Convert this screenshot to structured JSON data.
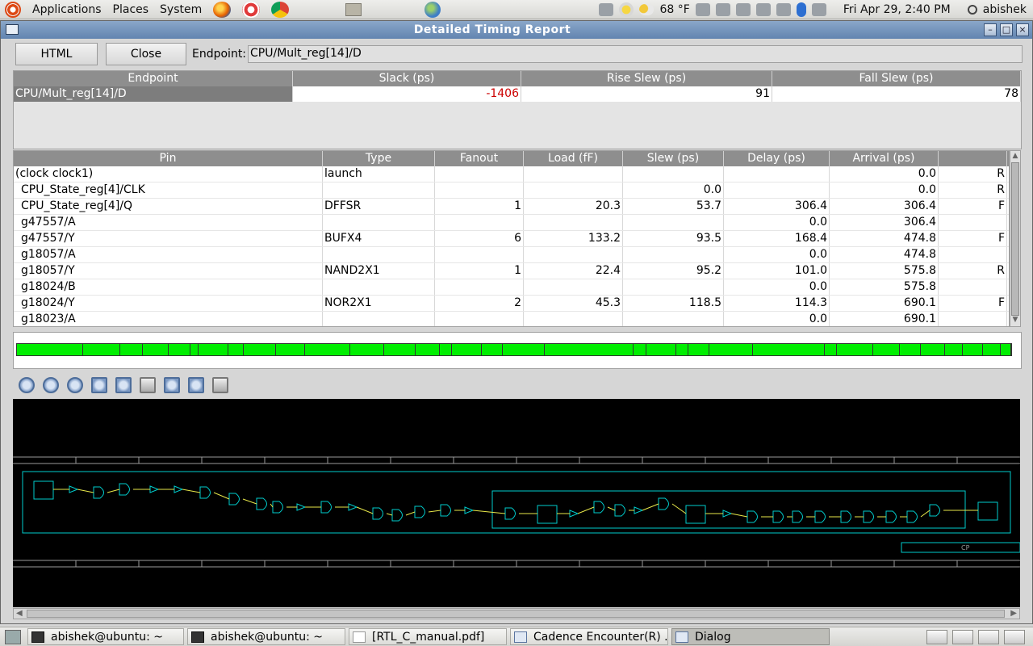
{
  "top_panel": {
    "menus": [
      "Applications",
      "Places",
      "System"
    ],
    "weather": "68 °F",
    "clock": "Fri Apr 29,  2:40 PM",
    "user": "abishek"
  },
  "window": {
    "title": "Detailed Timing Report",
    "html_label": "HTML",
    "close_label": "Close",
    "endpoint_label": "Endpoint:",
    "endpoint_value": "CPU/Mult_reg[14]/D"
  },
  "summary": {
    "headers": [
      "Endpoint",
      "Slack (ps)",
      "Rise Slew (ps)",
      "Fall Slew (ps)"
    ],
    "row": {
      "endpoint": "CPU/Mult_reg[14]/D",
      "slack": "-1406",
      "rise": "91",
      "fall": "78"
    }
  },
  "path": {
    "headers": [
      "Pin",
      "Type",
      "Fanout",
      "Load (fF)",
      "Slew (ps)",
      "Delay (ps)",
      "Arrival (ps)",
      ""
    ],
    "rows": [
      {
        "pin": "(clock clock1)",
        "type": "launch",
        "fanout": "",
        "load": "",
        "slew": "",
        "delay": "",
        "arrival": "0.0",
        "edge": "R",
        "indent": false
      },
      {
        "pin": "CPU_State_reg[4]/CLK",
        "type": "",
        "fanout": "",
        "load": "",
        "slew": "0.0",
        "delay": "",
        "arrival": "0.0",
        "edge": "R",
        "indent": true
      },
      {
        "pin": "CPU_State_reg[4]/Q",
        "type": "DFFSR",
        "fanout": "1",
        "load": "20.3",
        "slew": "53.7",
        "delay": "306.4",
        "arrival": "306.4",
        "edge": "F",
        "indent": true
      },
      {
        "pin": "g47557/A",
        "type": "",
        "fanout": "",
        "load": "",
        "slew": "",
        "delay": "0.0",
        "arrival": "306.4",
        "edge": "",
        "indent": true
      },
      {
        "pin": "g47557/Y",
        "type": "BUFX4",
        "fanout": "6",
        "load": "133.2",
        "slew": "93.5",
        "delay": "168.4",
        "arrival": "474.8",
        "edge": "F",
        "indent": true
      },
      {
        "pin": "g18057/A",
        "type": "",
        "fanout": "",
        "load": "",
        "slew": "",
        "delay": "0.0",
        "arrival": "474.8",
        "edge": "",
        "indent": true
      },
      {
        "pin": "g18057/Y",
        "type": "NAND2X1",
        "fanout": "1",
        "load": "22.4",
        "slew": "95.2",
        "delay": "101.0",
        "arrival": "575.8",
        "edge": "R",
        "indent": true
      },
      {
        "pin": "g18024/B",
        "type": "",
        "fanout": "",
        "load": "",
        "slew": "",
        "delay": "0.0",
        "arrival": "575.8",
        "edge": "",
        "indent": true
      },
      {
        "pin": "g18024/Y",
        "type": "NOR2X1",
        "fanout": "2",
        "load": "45.3",
        "slew": "118.5",
        "delay": "114.3",
        "arrival": "690.1",
        "edge": "F",
        "indent": true
      },
      {
        "pin": "g18023/A",
        "type": "",
        "fanout": "",
        "load": "",
        "slew": "",
        "delay": "0.0",
        "arrival": "690.1",
        "edge": "",
        "indent": true
      }
    ]
  },
  "delay_bar": {
    "segment_widths": [
      88,
      50,
      30,
      34,
      30,
      10,
      40,
      20,
      44,
      38,
      60,
      46,
      42,
      32,
      16,
      40,
      28,
      56,
      118,
      18,
      40,
      16,
      28,
      58,
      96,
      16,
      48,
      36,
      28,
      32,
      24,
      26,
      24,
      14
    ]
  },
  "schematic": {
    "label": "CP"
  },
  "taskbar": {
    "tasks": [
      "abishek@ubuntu: ~",
      "abishek@ubuntu: ~",
      "[RTL_C_manual.pdf]",
      "Cadence Encounter(R) ...",
      "Dialog"
    ]
  }
}
